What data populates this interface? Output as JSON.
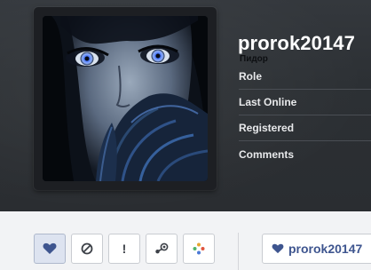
{
  "profile": {
    "username": "prorok20147",
    "user_title": "Пидор",
    "info_rows": [
      {
        "label": "Role"
      },
      {
        "label": "Last Online"
      },
      {
        "label": "Registered"
      },
      {
        "label": "Comments"
      }
    ]
  },
  "actions": {
    "buttons": [
      {
        "icon": "heart-icon",
        "active": true
      },
      {
        "icon": "block-icon",
        "active": false
      },
      {
        "icon": "report-icon",
        "glyph": "!",
        "active": false
      },
      {
        "icon": "steam-icon",
        "active": false
      },
      {
        "icon": "flower-icon",
        "active": false
      }
    ],
    "follow_label": "prorok20147"
  },
  "colors": {
    "accent": "#3e558f",
    "banner": "#2c3034",
    "background": "#f2f3f5"
  }
}
